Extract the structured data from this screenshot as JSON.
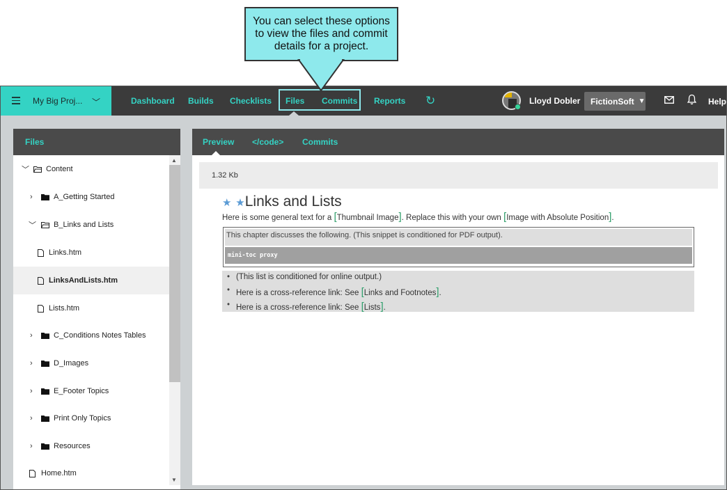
{
  "callout": {
    "text": "You can select these options to view the files and commit details for a project."
  },
  "topbar": {
    "project_name": "My Big Proj...",
    "nav": {
      "dashboard": "Dashboard",
      "builds": "Builds",
      "checklists": "Checklists",
      "files": "Files",
      "commits": "Commits",
      "reports": "Reports"
    },
    "user_name": "Lloyd Dobler",
    "org": "FictionSoft",
    "help": "Help"
  },
  "files_panel": {
    "title": "Files",
    "tree": [
      {
        "label": "Content",
        "type": "folder",
        "state": "open"
      },
      {
        "label": "A_Getting Started",
        "type": "folder",
        "state": "closed"
      },
      {
        "label": "B_Links and Lists",
        "type": "folder",
        "state": "open"
      },
      {
        "label": "Links.htm",
        "type": "file"
      },
      {
        "label": "LinksAndLists.htm",
        "type": "file",
        "selected": true
      },
      {
        "label": "Lists.htm",
        "type": "file"
      },
      {
        "label": "C_Conditions Notes Tables",
        "type": "folder",
        "state": "closed"
      },
      {
        "label": "D_Images",
        "type": "folder",
        "state": "closed"
      },
      {
        "label": "E_Footer Topics",
        "type": "folder",
        "state": "closed"
      },
      {
        "label": "Print Only Topics",
        "type": "folder",
        "state": "closed"
      },
      {
        "label": "Resources",
        "type": "folder",
        "state": "closed"
      },
      {
        "label": "Home.htm",
        "type": "file"
      }
    ]
  },
  "preview_panel": {
    "tabs": {
      "preview": "Preview",
      "code": "</code>",
      "commits": "Commits"
    },
    "file_size": "1.32 Kb",
    "doc": {
      "title": "Links and Lists",
      "intro_before": "Here is some general text for a ",
      "intro_link1": "Thumbnail Image",
      "intro_middle": ". Replace this with your own ",
      "intro_link2": "Image with Absolute Position",
      "intro_after": ".",
      "snippet_text": "This chapter discusses the following. (This snippet is conditioned for PDF output).",
      "minitoc": "mini-toc proxy",
      "list": {
        "item1": "(This list is conditioned for online output.)",
        "item2_prefix": "Here is a cross-reference link: See ",
        "item2_link": "Links and Footnotes",
        "item2_suffix": ".",
        "item3_prefix": "Here is a cross-reference link: See ",
        "item3_link": "Lists",
        "item3_suffix": "."
      }
    }
  },
  "colors": {
    "accent": "#34d3c4",
    "callout": "#8ee9ec",
    "topbar": "#3b3b3b",
    "bracket": "#2e9e6a"
  }
}
